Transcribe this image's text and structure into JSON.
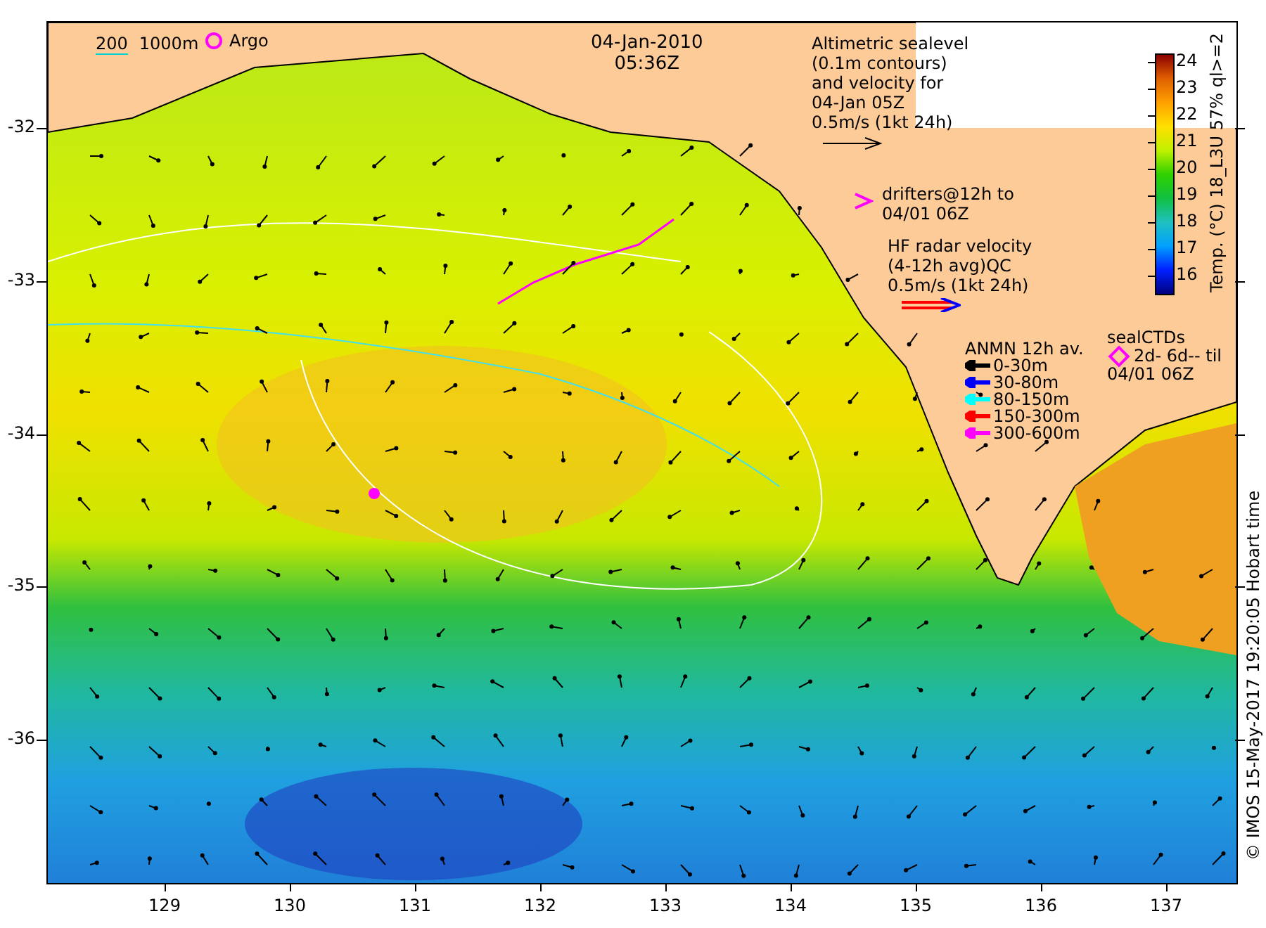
{
  "map": {
    "date": "04-Jan-2010",
    "time": "05:36Z",
    "scale_legend": {
      "short_label": "200",
      "long_label": "1000m"
    },
    "argo_legend": "Argo",
    "altimetry_legend": [
      "Altimetric sealevel",
      "(0.1m contours)",
      "and velocity for",
      "04-Jan 05Z",
      "0.5m/s (1kt 24h)"
    ],
    "drifters_legend": [
      "drifters@12h to",
      "04/01 06Z"
    ],
    "hf_radar_legend": [
      "HF radar velocity",
      "(4-12h avg)QC",
      "0.5m/s (1kt 24h)"
    ],
    "anmn_legend": {
      "title": "ANMN 12h av.",
      "items": [
        {
          "label": "0-30m",
          "color": "#000000"
        },
        {
          "label": "30-80m",
          "color": "#0000ff"
        },
        {
          "label": "80-150m",
          "color": "#00ffff"
        },
        {
          "label": "150-300m",
          "color": "#ff0000"
        },
        {
          "label": "300-600m",
          "color": "#ff00ff"
        }
      ]
    },
    "seal_legend": [
      "sealCTDs",
      "2d- 6d-- til",
      "04/01 06Z"
    ],
    "lat_ticks": [
      "-32",
      "-33",
      "-34",
      "-35",
      "-36"
    ],
    "lon_ticks": [
      "129",
      "130",
      "131",
      "132",
      "133",
      "134",
      "135",
      "136",
      "137"
    ]
  },
  "colorbar": {
    "label": "Temp. (°C) 18_L3U 57% ql>=2",
    "ticks": [
      "24",
      "23",
      "22",
      "21",
      "20",
      "19",
      "18",
      "17",
      "16"
    ]
  },
  "credit": "© IMOS 15-May-2017 19:20:05 Hobart time"
}
